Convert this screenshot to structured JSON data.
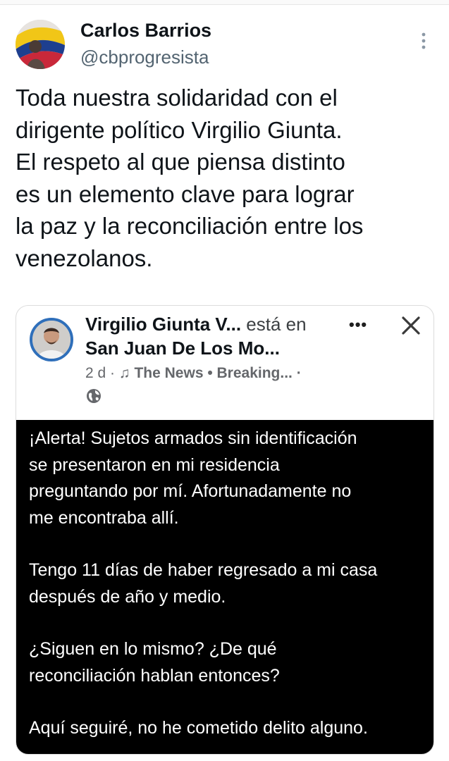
{
  "tweet": {
    "author_name": "Carlos Barrios",
    "author_handle": "@cbprogresista",
    "text": "Toda nuestra solidaridad con el\ndirigente político Virgilio Giunta.\nEl respeto al que piensa distinto\nes un elemento clave para lograr\nla paz y la reconciliación entre los\nvenezolanos.",
    "more_icon": "more-vertical-icon"
  },
  "embedded_post": {
    "author": "Virgilio Giunta V...",
    "is_at": "está en",
    "location": "San Juan De Los Mo...",
    "time": "2 d ·",
    "music": "The News • Breaking... ·",
    "privacy_icon": "globe-icon",
    "close_icon": "close-icon",
    "more_icon": "more-horizontal-icon",
    "text_lines": [
      "¡Alerta! Sujetos armados sin identificación\nse presentaron en mi residencia\npreguntando por mí. Afortunadamente no\nme encontraba allí.",
      "Tengo 11 días de haber regresado a mi casa\ndespués de año y medio.",
      "¿Siguen en lo mismo? ¿De qué\nreconciliación hablan entonces?",
      "Aquí seguiré, no he cometido delito alguno."
    ]
  },
  "colors": {
    "text": "#0f1419",
    "secondary": "#536471",
    "post_bg": "#000000",
    "post_text": "#ffffff",
    "avatar_ring": "#2f6fba"
  }
}
